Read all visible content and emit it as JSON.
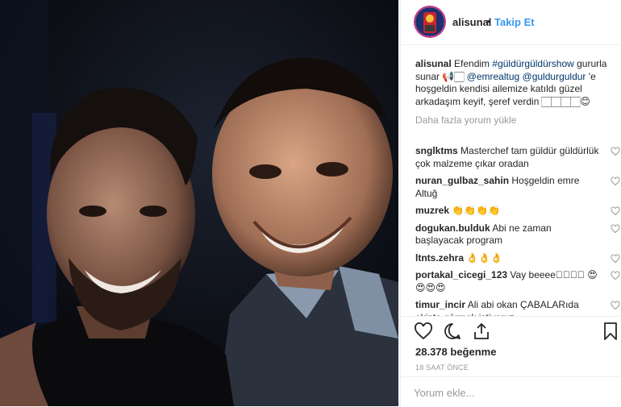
{
  "header": {
    "username": "alisunal",
    "separator": "•",
    "follow_label": "Takip Et"
  },
  "caption": {
    "username": "alisunal",
    "t1": " Efendim ",
    "hashtag": "#güldürgüldürshow",
    "t2": " gururla sunar 📢🏻 ",
    "mention1": "@emrealtug",
    "t3": " ",
    "mention2": "@guldurguldur",
    "t4": " 'e hoşgeldin kendisi ailemize katıldı güzel arkadaşım keyif, şeref verdin 🏻🏻🏻🏻😊"
  },
  "load_more": "Daha fazla yorum yükle",
  "comments": [
    {
      "username": "snglktms",
      "text": " Masterchef tam güldür güldürlük çok malzeme çıkar oradan"
    },
    {
      "username": "nuran_gulbaz_sahin",
      "text": " Hoşgeldin emre Altuğ"
    },
    {
      "username": "muzrek",
      "text": " 👏👏👏👏"
    },
    {
      "username": "dogukan.bulduk",
      "text": " Abi ne zaman başlayacak program"
    },
    {
      "username": "ltnts.zehra",
      "text": " 👌👌👌"
    },
    {
      "username": "portakal_cicegi_123",
      "text": " Vay beeee🏻🏻🏻🏻 😍😍😍😍"
    },
    {
      "username": "timur_incir",
      "text": " Ali abi okan ÇABALARıda ekipte görmek istiyoruz"
    }
  ],
  "likes": "28.378 beğenme",
  "time": "18 SAAT ÖNCE",
  "comment_placeholder": "Yorum ekle...",
  "colors": {
    "link": "#003569",
    "follow": "#3897f0",
    "muted": "#999999",
    "text": "#262626"
  }
}
